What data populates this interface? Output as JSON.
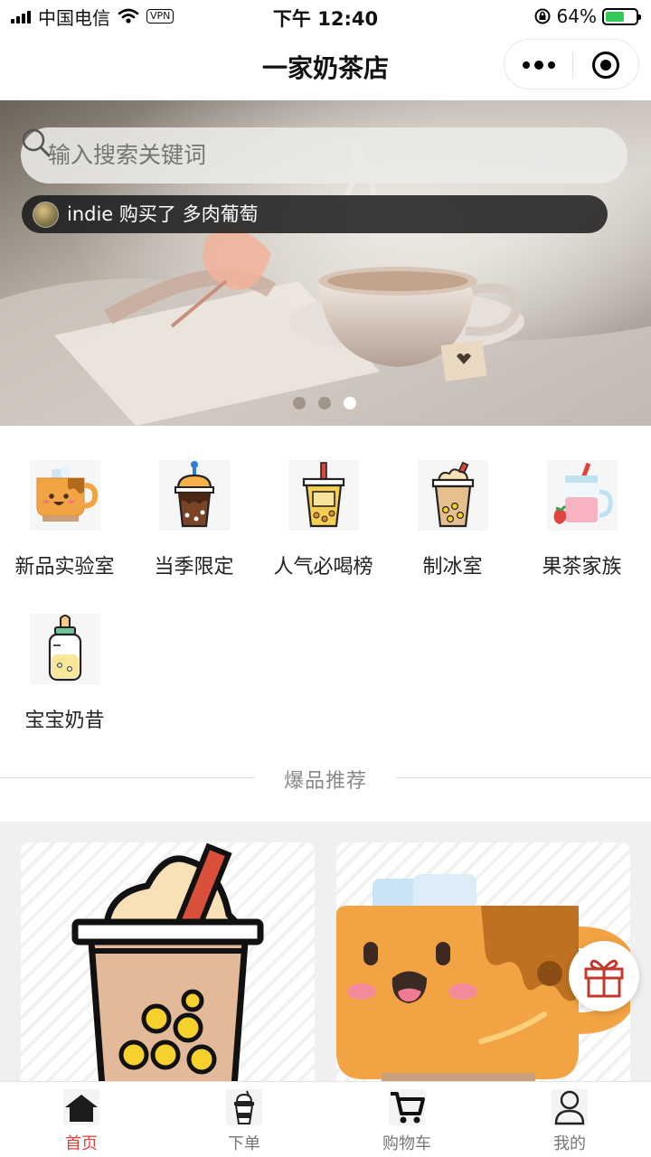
{
  "status_bar": {
    "carrier": "中国电信",
    "vpn": "VPN",
    "time": "下午 12:40",
    "battery": "64%",
    "battery_level": 0.64
  },
  "nav": {
    "title": "一家奶茶店"
  },
  "search": {
    "placeholder": "输入搜索关键词"
  },
  "notice": {
    "text": "indie 购买了 多肉葡萄"
  },
  "banner": {
    "slide_count": 3,
    "active_slide": 3
  },
  "categories": [
    {
      "label": "新品实验室",
      "icon": "cute-cup-icon"
    },
    {
      "label": "当季限定",
      "icon": "chocolate-drink-icon"
    },
    {
      "label": "人气必喝榜",
      "icon": "boba-cup-icon"
    },
    {
      "label": "制冰室",
      "icon": "iced-boba-icon"
    },
    {
      "label": "果茶家族",
      "icon": "fruit-tea-jar-icon"
    },
    {
      "label": "宝宝奶昔",
      "icon": "baby-bottle-icon"
    }
  ],
  "section": {
    "title": "爆品推荐"
  },
  "products": [
    {
      "icon": "boba-milk-tea-icon"
    },
    {
      "icon": "smiling-cup-icon"
    }
  ],
  "tabs": [
    {
      "label": "首页",
      "icon": "home-icon",
      "active": true
    },
    {
      "label": "下单",
      "icon": "drink-cup-icon",
      "active": false
    },
    {
      "label": "购物车",
      "icon": "cart-icon",
      "active": false
    },
    {
      "label": "我的",
      "icon": "person-icon",
      "active": false
    }
  ],
  "colors": {
    "accent": "#e0443c",
    "tab_inactive": "#777777"
  }
}
